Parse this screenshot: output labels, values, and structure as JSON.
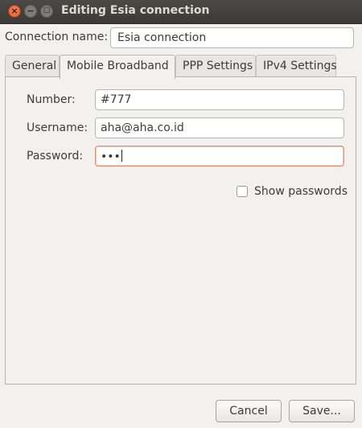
{
  "window": {
    "title": "Editing Esia connection"
  },
  "connection": {
    "label": "Connection name:",
    "value": "Esia connection"
  },
  "tabs": [
    {
      "label": "General"
    },
    {
      "label": "Mobile Broadband"
    },
    {
      "label": "PPP Settings"
    },
    {
      "label": "IPv4 Settings"
    }
  ],
  "mobile_broadband": {
    "number_label": "Number:",
    "number_value": "#777",
    "username_label": "Username:",
    "username_value": "aha@aha.co.id",
    "password_label": "Password:",
    "password_value": "•••",
    "show_passwords_label": "Show passwords"
  },
  "buttons": {
    "cancel": "Cancel",
    "save": "Save..."
  },
  "icons": {
    "close": "close-icon",
    "minimize": "minimize-icon",
    "maximize": "maximize-icon"
  },
  "colors": {
    "focus_border": "#e2916e",
    "titlebar": "#3b3a36",
    "close_button": "#e25a2b"
  }
}
